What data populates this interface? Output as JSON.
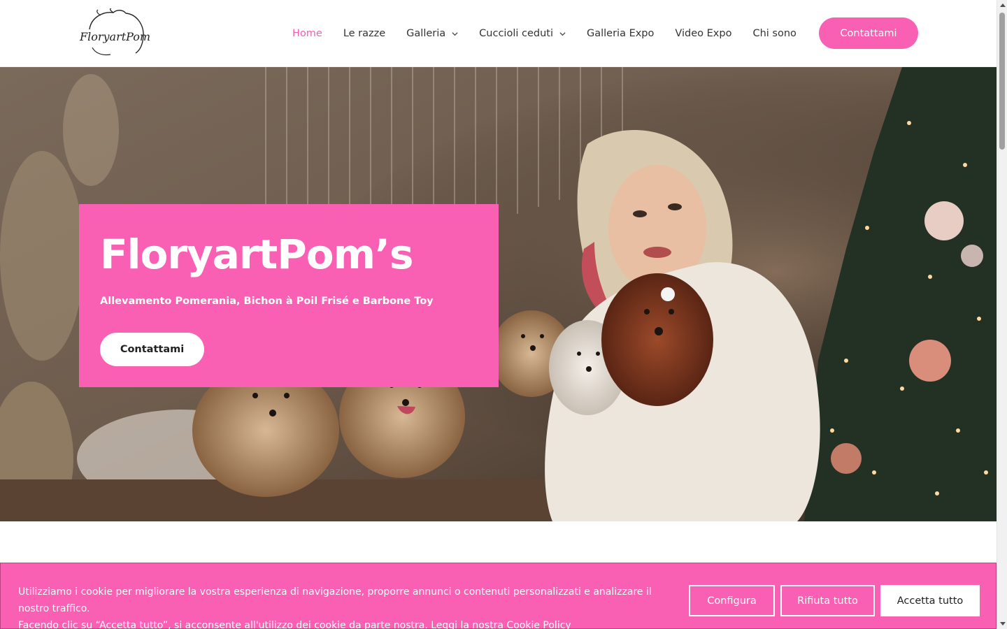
{
  "header": {
    "logo_text": "FloryartPom's",
    "nav": [
      {
        "label": "Home",
        "active": true,
        "dropdown": false
      },
      {
        "label": "Le razze",
        "active": false,
        "dropdown": false
      },
      {
        "label": "Galleria",
        "active": false,
        "dropdown": true
      },
      {
        "label": "Cuccioli ceduti",
        "active": false,
        "dropdown": true
      },
      {
        "label": "Galleria Expo",
        "active": false,
        "dropdown": false
      },
      {
        "label": "Video Expo",
        "active": false,
        "dropdown": false
      },
      {
        "label": "Chi sono",
        "active": false,
        "dropdown": false
      }
    ],
    "cta_label": "Contattami"
  },
  "hero": {
    "title": "FloryartPom’s",
    "subtitle": "Allevamento Pomerania, Bichon à Poil Frisé e Barbone Toy",
    "button_label": "Contattami"
  },
  "cookie_banner": {
    "text_line1": "Utilizziamo i cookie per migliorare la vostra esperienza di navigazione, proporre annunci o contenuti personalizzati e analizzare il nostro traffico.",
    "text_line2": "Facendo clic su “Accetta tutto”, si acconsente all'utilizzo dei cookie da parte nostra. Leggi la nostra",
    "policy_link": "Cookie Policy",
    "configure_label": "Configura",
    "reject_label": "Rifiuta tutto",
    "accept_label": "Accetta tutto"
  },
  "colors": {
    "brand_pink": "#f95fb2",
    "nav_active": "#f25fb0",
    "text_dark": "#333333"
  },
  "icons": {
    "dropdown": "chevron-down-icon",
    "logo": "dog-head-logo"
  }
}
